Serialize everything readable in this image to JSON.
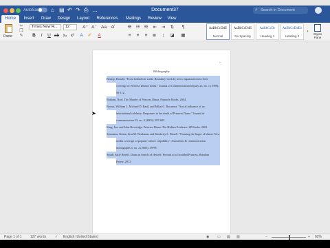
{
  "titlebar": {
    "autosave_label": "AutoSave",
    "doc_title": "Document37",
    "search_placeholder": "Search in Document",
    "colors": {
      "close": "#ee5d57",
      "minimize": "#f5bd4f",
      "maximize": "#5fc653"
    }
  },
  "tabs": [
    {
      "label": "Home",
      "active": true
    },
    {
      "label": "Insert"
    },
    {
      "label": "Draw"
    },
    {
      "label": "Design"
    },
    {
      "label": "Layout"
    },
    {
      "label": "References"
    },
    {
      "label": "Mailings"
    },
    {
      "label": "Review"
    },
    {
      "label": "View"
    }
  ],
  "ribbon": {
    "paste_label": "Paste",
    "font_name": "Times New R...",
    "font_size": "12",
    "styles": [
      {
        "sample": "AaBbCcDdE",
        "name": "Normal"
      },
      {
        "sample": "AaBbCcDdE",
        "name": "No Spacing"
      },
      {
        "sample": "AaBbCcDc",
        "name": "Heading 1"
      },
      {
        "sample": "AaBbCcDdEe",
        "name": "Heading 2"
      }
    ],
    "styles_pane_label": "Styles Pane"
  },
  "document": {
    "title": "Bibliography",
    "entries": [
      {
        "lines": [
          "Bishop, Ronald. \"From behind the walls: Boundary work by news organizations in their",
          "coverage of Princess Diana's death.\" Journal of Communication Inquiry 23, no. 1 (1999):",
          "90-112."
        ]
      },
      {
        "lines": [
          "Botham, Noel. The Murder of Princess Diana. Pinnacle Books, 2004."
        ]
      },
      {
        "lines": [
          "Brown, William J., Michael D. Basil, and Mihai C. Bocarnea. \"Social influence of an",
          "international celebrity: Responses to the death of Princess Diana.\" Journal of",
          "communication 53, no. 4 (2003): 587-605."
        ]
      },
      {
        "lines": [
          "King, Jon, and John Beveridge. Princess Diana: The Hidden Evidence. SP Books, 2001."
        ]
      },
      {
        "lines": [
          "Simonton, Krista, Lisa M. Workman, and Kimberly L. Bissell. \"Framing the finger of blame: News",
          "media coverage of popular-culture culpability.\" Journalism & communication",
          "monographs 5, no. 2 (2003): 49-99."
        ]
      },
      {
        "lines": [
          "Smith, Sally Bedell. Diana in Search of Herself: Portrait of a Troubled Princess. Random",
          "House, 2012."
        ]
      }
    ]
  },
  "statusbar": {
    "page": "Page 1 of 1",
    "words": "127 words",
    "language": "English (United States)",
    "zoom": "62%"
  }
}
